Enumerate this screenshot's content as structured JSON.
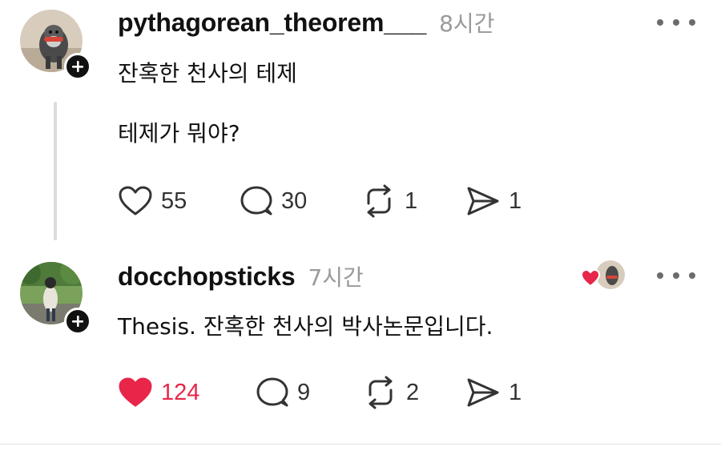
{
  "posts": [
    {
      "username": "pythagorean_theorem___",
      "time": "8시간",
      "lines": [
        "잔혹한 천사의 테제",
        "테제가 뭐야?"
      ],
      "counts": {
        "likes": "55",
        "comments": "30",
        "reposts": "1",
        "shares": "1"
      },
      "liked": false
    },
    {
      "username": "docchopsticks",
      "time": "7시간",
      "lines": [
        "Thesis. 잔혹한 천사의 박사논문입니다."
      ],
      "counts": {
        "likes": "124",
        "comments": "9",
        "reposts": "2",
        "shares": "1"
      },
      "liked": true
    }
  ],
  "colors": {
    "like_active": "#e8264a",
    "text_primary": "#111111",
    "text_secondary": "#9a9a9a",
    "icon": "#333333",
    "thread_line": "#dcdcdc"
  },
  "icons": [
    "heart-icon",
    "comment-icon",
    "repost-icon",
    "share-icon",
    "plus-icon",
    "more-icon"
  ]
}
